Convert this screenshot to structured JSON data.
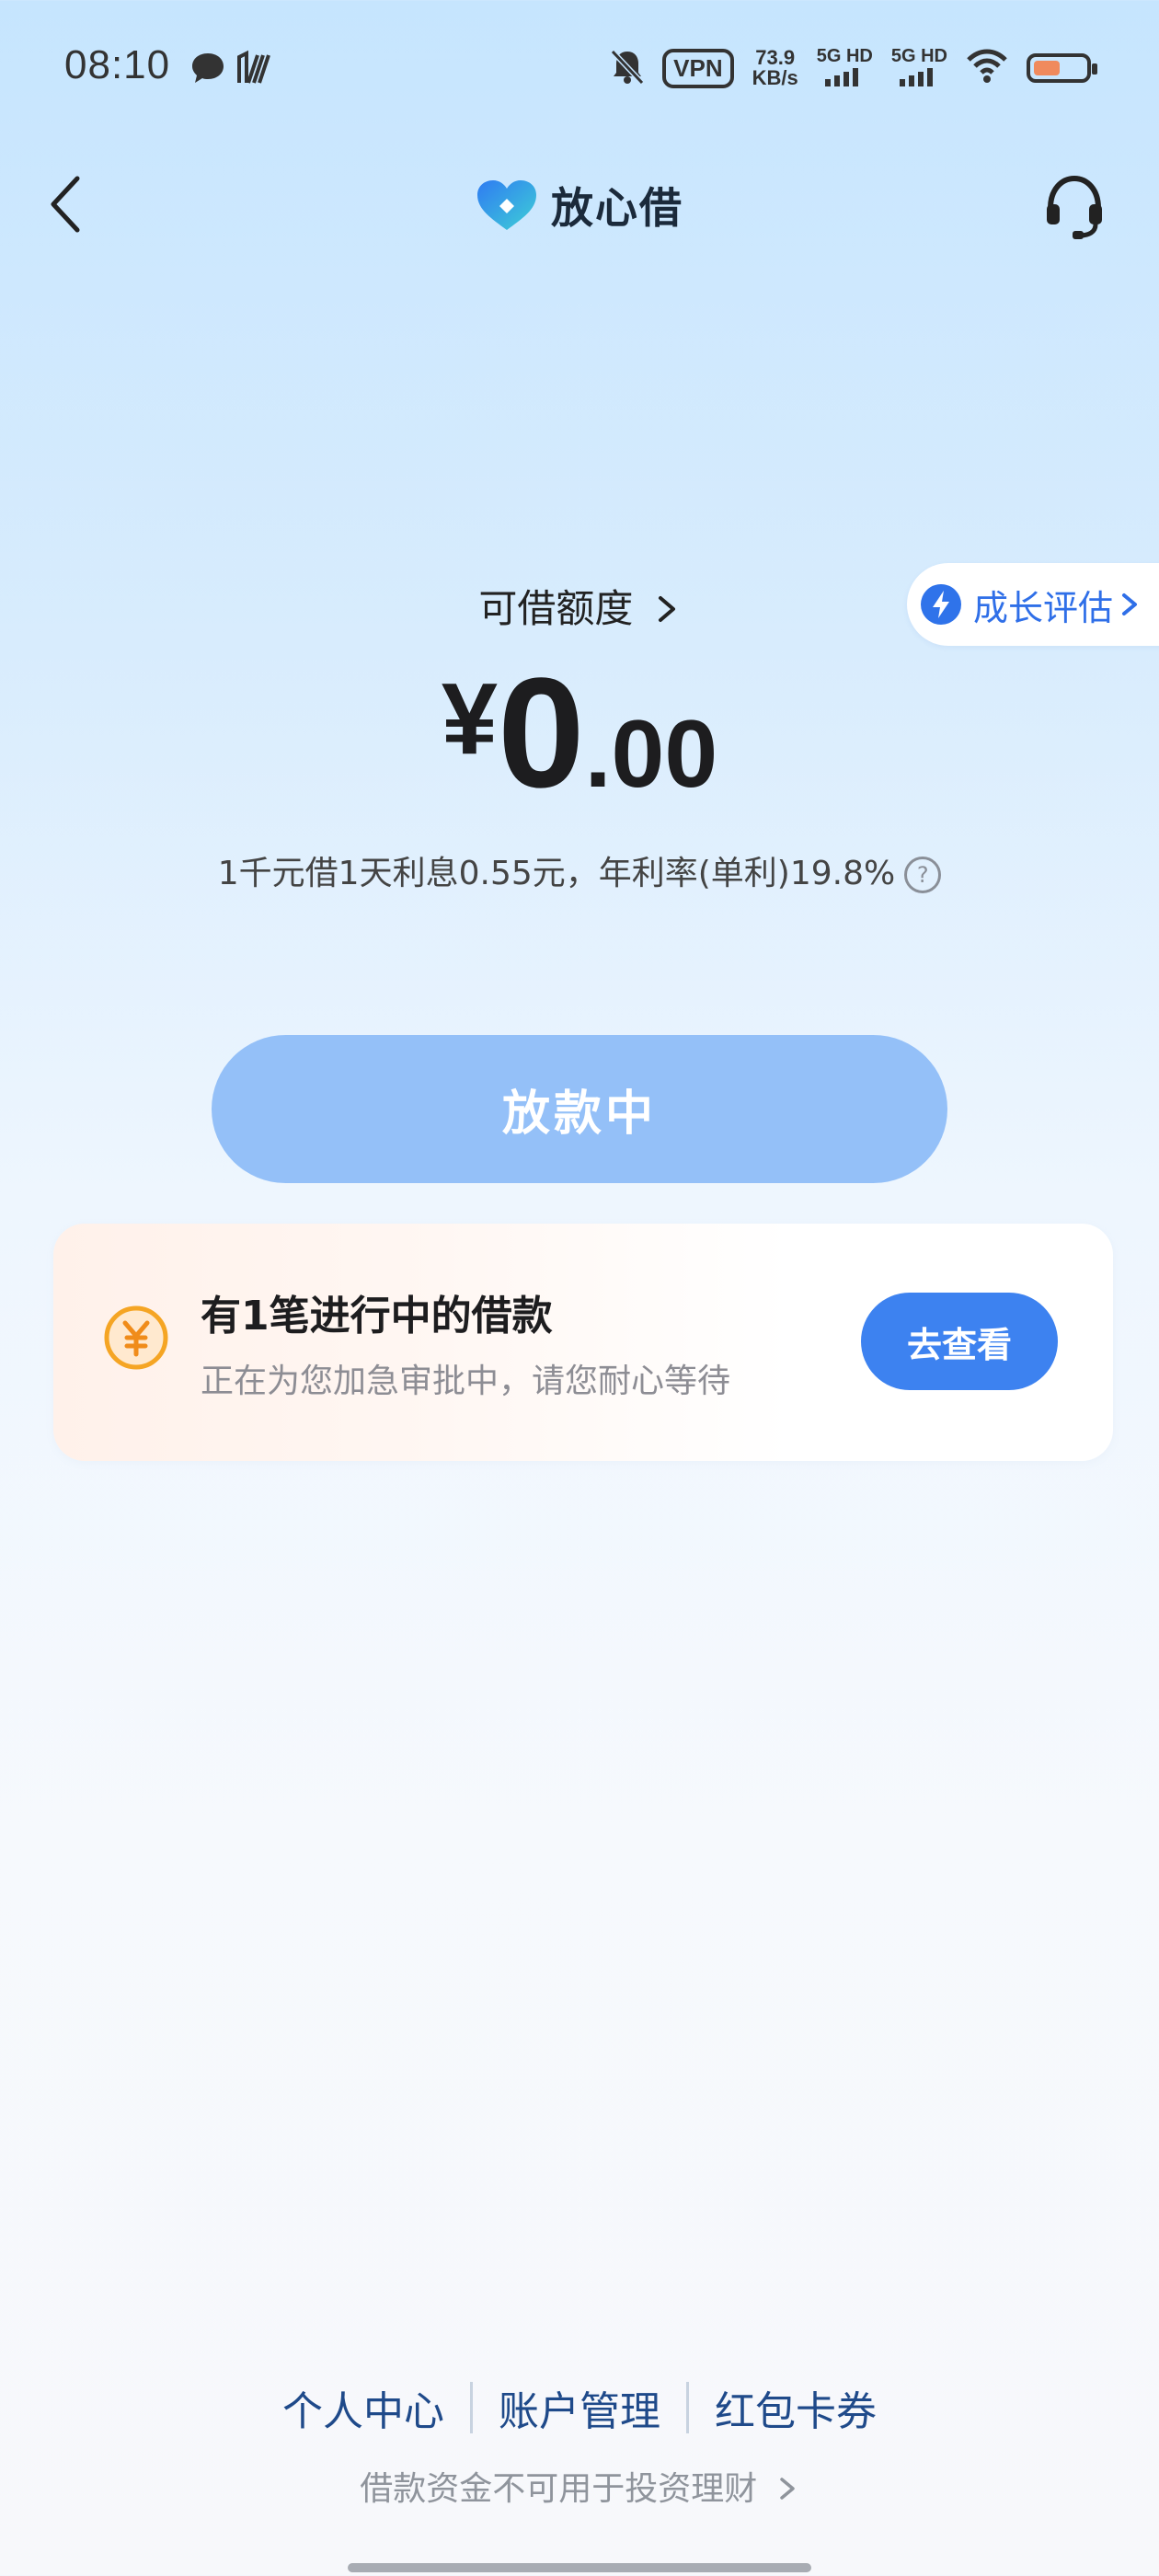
{
  "status_bar": {
    "time": "08:10",
    "vpn": "VPN",
    "speed_value": "73.9",
    "speed_unit": "KB/s",
    "net1": "5G HD",
    "net2": "5G HD"
  },
  "nav": {
    "brand_name": "放心借"
  },
  "quota": {
    "label": "可借额度",
    "currency": "¥",
    "amount_integer": "0",
    "amount_decimal": ".00",
    "rate_text": "1千元借1天利息0.55元，年利率(单利)19.8%",
    "help_symbol": "?"
  },
  "growth": {
    "label": "成长评估"
  },
  "main_button": {
    "label": "放款中"
  },
  "loan_card": {
    "title": "有1笔进行中的借款",
    "subtitle": "正在为您加急审批中，请您耐心等待",
    "button": "去查看"
  },
  "footer": {
    "links": [
      "个人中心",
      "账户管理",
      "红包卡券"
    ],
    "disclaimer": "借款资金不可用于投资理财"
  },
  "colors": {
    "accent": "#3d82f0",
    "button_disabled": "#94c0f8",
    "coin": "#f5a524",
    "link": "#1f4a8a"
  }
}
